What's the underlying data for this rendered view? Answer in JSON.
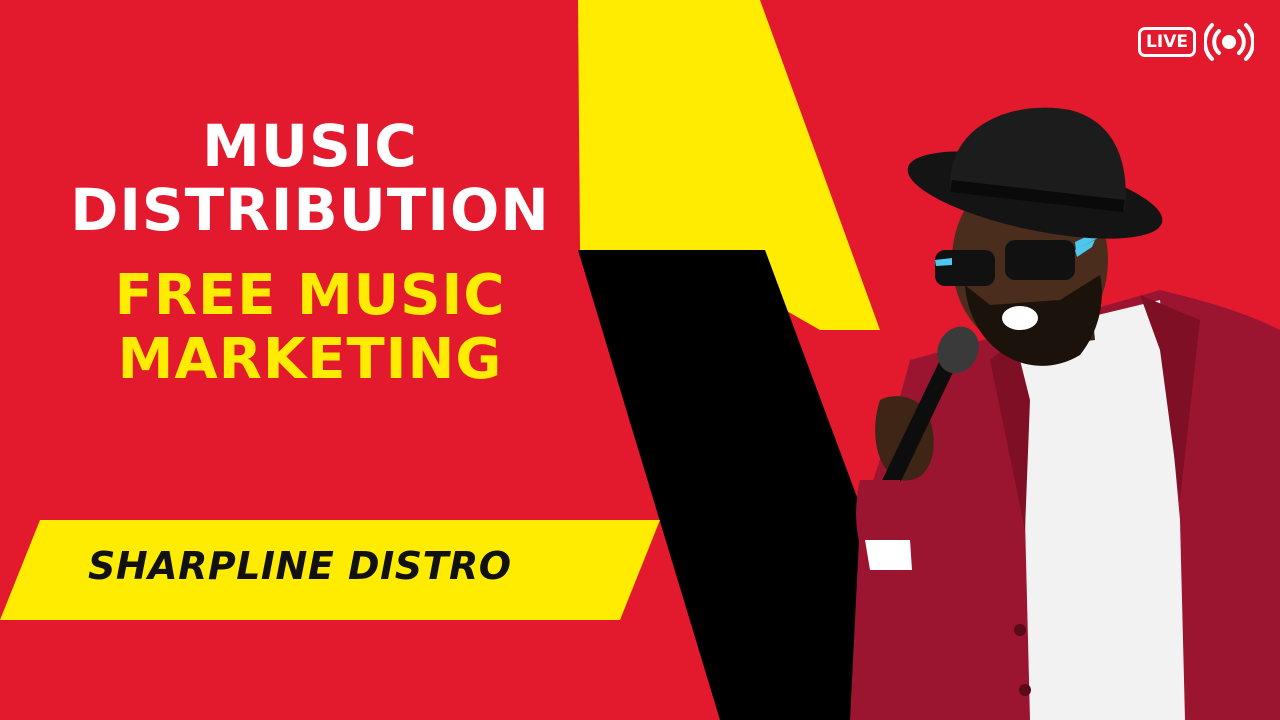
{
  "headline": {
    "line1": "MUSIC",
    "line2": "DISTRIBUTION",
    "line3": "FREE MUSIC",
    "line4": "MARKETING"
  },
  "brand_label": "SHARPLINE DISTRO",
  "live_badge": "LIVE",
  "colors": {
    "background": "#e3192d",
    "accent_yellow": "#ffec00",
    "black": "#000000",
    "text_white": "#ffffff"
  },
  "icons": [
    "live-badge-icon",
    "broadcast-icon"
  ]
}
